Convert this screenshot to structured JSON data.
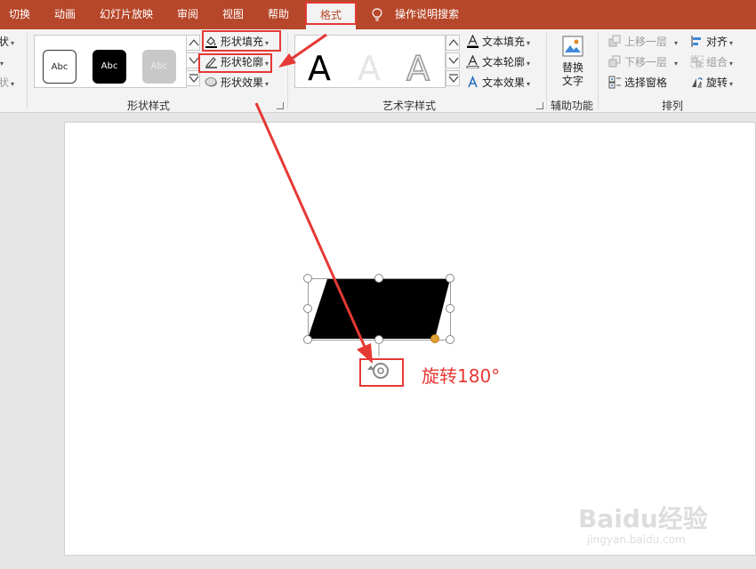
{
  "tabs": [
    "切换",
    "动画",
    "幻灯片放映",
    "审阅",
    "视图",
    "帮助",
    "格式"
  ],
  "tell_me": "操作说明搜索",
  "left_cutoff": [
    "状",
    "",
    "状"
  ],
  "shape_styles": {
    "thumbs": [
      "Abc",
      "Abc",
      "Abc"
    ],
    "fill": "形状填充",
    "outline": "形状轮廓",
    "effects": "形状效果",
    "label": "形状样式"
  },
  "wordart": {
    "letters": [
      "A",
      "A",
      "A"
    ],
    "text_fill": "文本填充",
    "text_outline": "文本轮廓",
    "text_effects": "文本效果",
    "label": "艺术字样式"
  },
  "accessibility": {
    "alt_text_line1": "替换",
    "alt_text_line2": "文字",
    "label": "辅助功能"
  },
  "arrange": {
    "bring_forward": "上移一层",
    "send_backward": "下移一层",
    "selection_pane": "选择窗格",
    "align": "对齐",
    "group": "组合",
    "rotate": "旋转",
    "label": "排列"
  },
  "annotation": "旋转180°",
  "watermark": "Baidu经验",
  "watermark_sub": "jingyan.baidu.com",
  "colors": {
    "accent": "#b7472a",
    "annotation": "#e53935",
    "handle_yellow": "#e0a030"
  }
}
